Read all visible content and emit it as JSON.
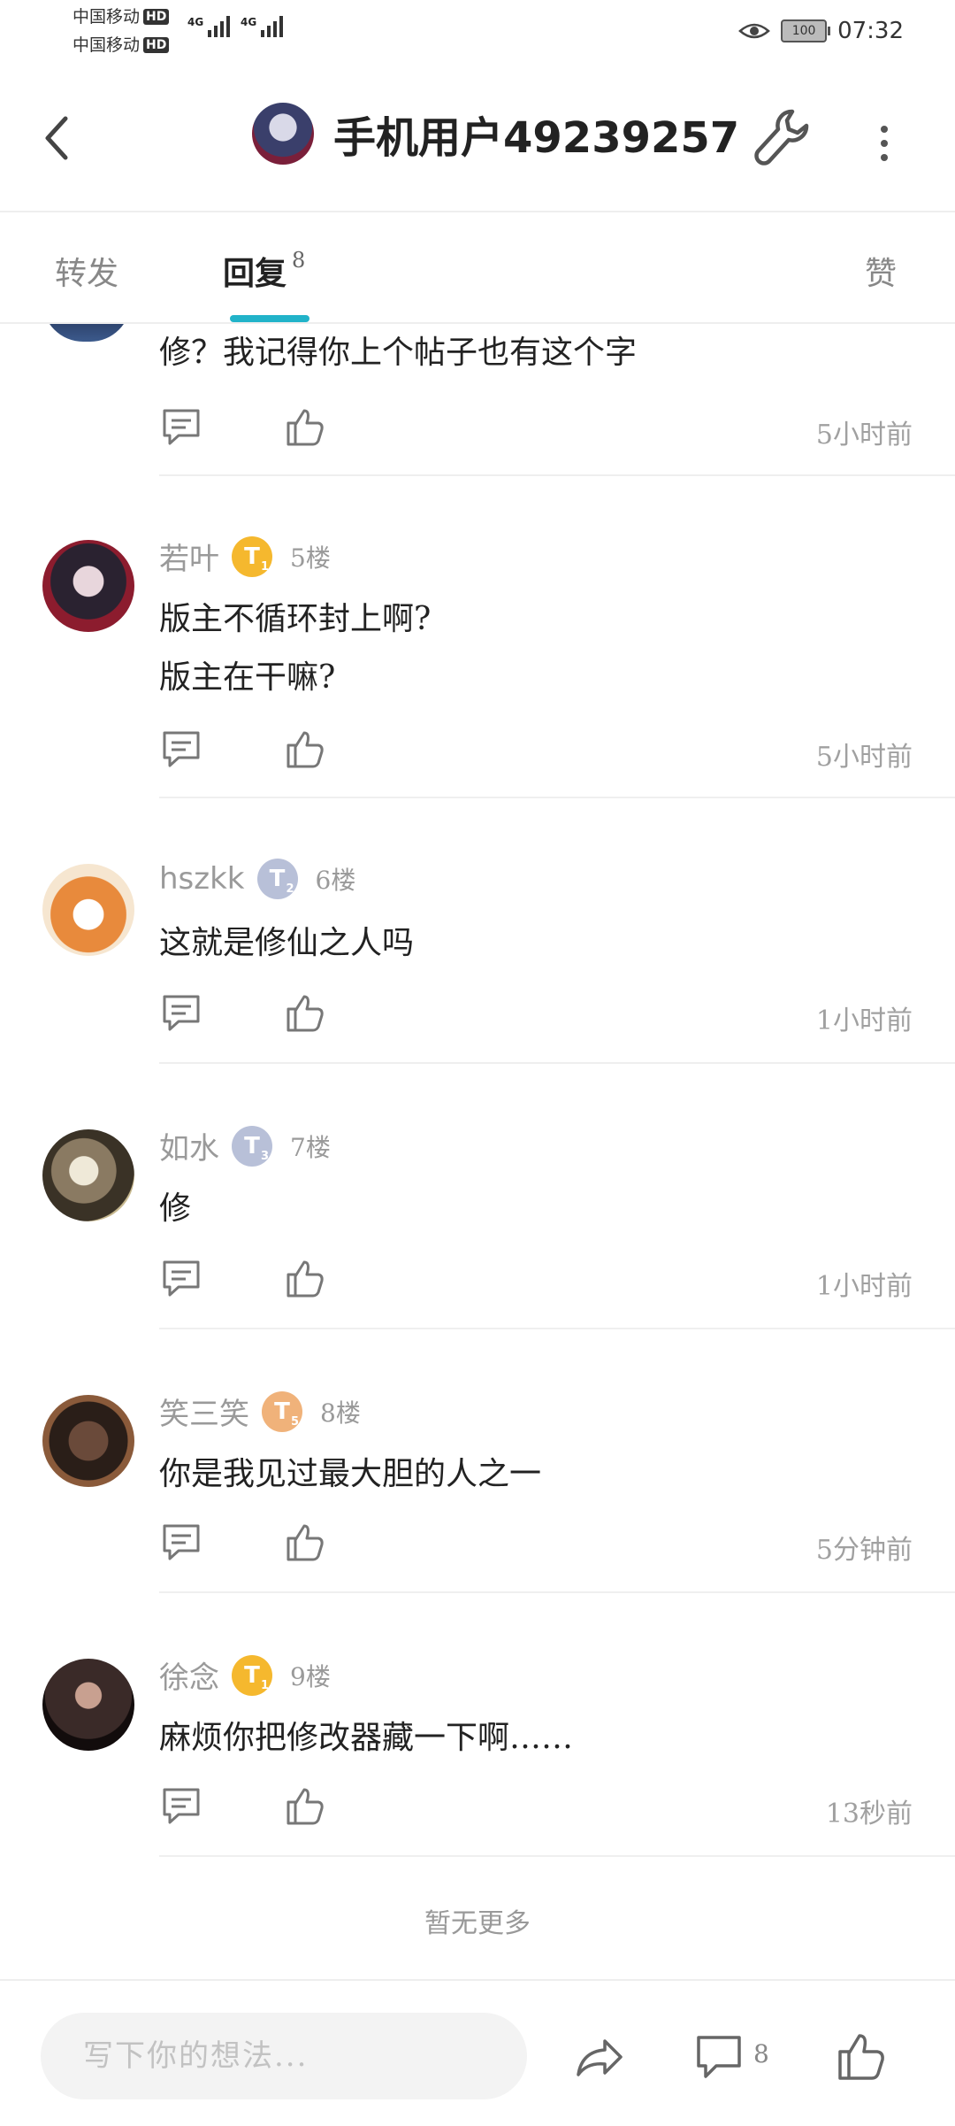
{
  "status_bar": {
    "carrier1": "中国移动",
    "carrier2": "中国移动",
    "hd": "HD",
    "network": "4G",
    "battery": "100",
    "time": "07:32"
  },
  "header": {
    "title": "手机用户49239257"
  },
  "tabs": {
    "forward": "转发",
    "reply": "回复",
    "reply_count": "8",
    "like": "赞"
  },
  "comments": [
    {
      "user": "",
      "floor": "",
      "lines": [
        "修？我记得你上个帖子也有这个字"
      ],
      "time": "5小时前"
    },
    {
      "user": "若叶",
      "badge": "T",
      "badge_level": "1",
      "floor": "5楼",
      "lines": [
        "版主不循环封上啊?",
        "版主在干嘛?"
      ],
      "time": "5小时前"
    },
    {
      "user": "hszkk",
      "badge": "T",
      "badge_level": "2",
      "floor": "6楼",
      "lines": [
        "这就是修仙之人吗"
      ],
      "time": "1小时前"
    },
    {
      "user": "如水",
      "badge": "T",
      "badge_level": "3",
      "floor": "7楼",
      "lines": [
        "修"
      ],
      "time": "1小时前"
    },
    {
      "user": "笑三笑",
      "badge": "T",
      "badge_level": "5",
      "floor": "8楼",
      "lines": [
        "你是我见过最大胆的人之一"
      ],
      "time": "5分钟前"
    },
    {
      "user": "徐念",
      "badge": "T",
      "badge_level": "1",
      "floor": "9楼",
      "lines": [
        "麻烦你把修改器藏一下啊……"
      ],
      "time": "13秒前"
    }
  ],
  "no_more": "暂无更多",
  "bottom": {
    "placeholder": "写下你的想法...",
    "comment_count": "8"
  },
  "icons": [
    "back-arrow-icon",
    "wrench-icon",
    "more-vertical-icon",
    "reply-icon",
    "thumbs-up-icon",
    "share-icon",
    "comment-icon",
    "eye-icon"
  ],
  "colors": {
    "accent": "#21b3c9",
    "badge_gold": "#f5b82e",
    "badge_silver": "#b8c0d8",
    "badge_orange": "#f0b27a"
  }
}
